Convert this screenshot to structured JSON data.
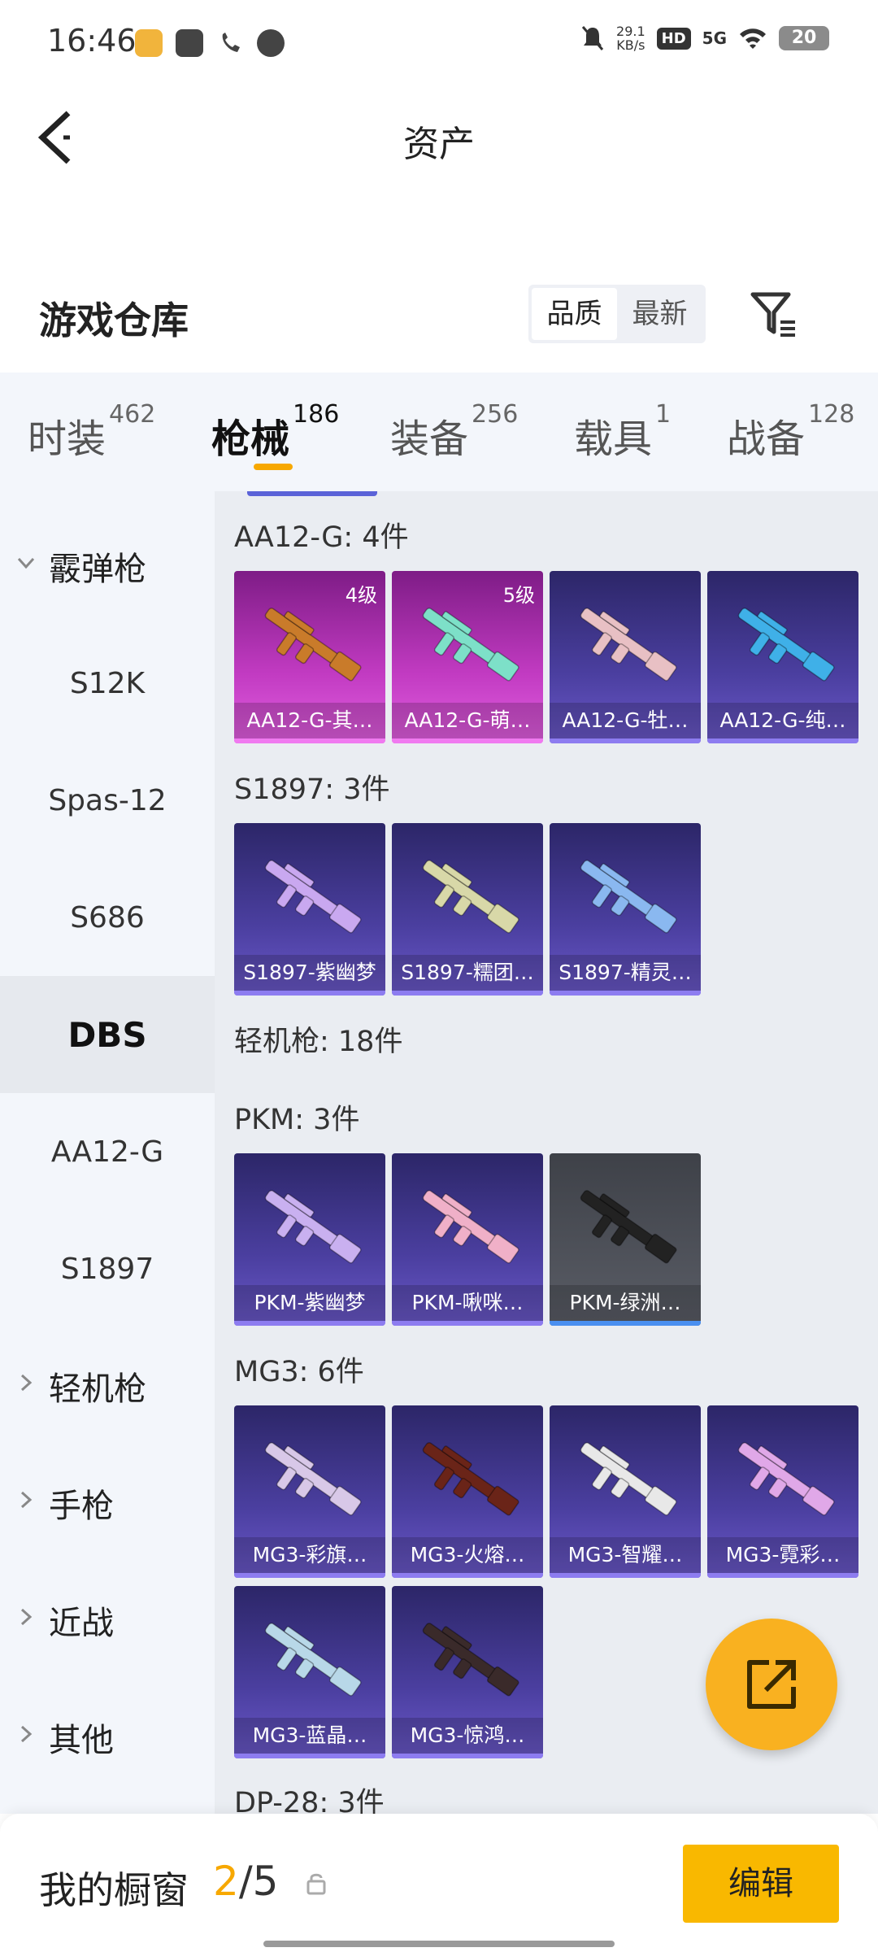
{
  "status_bar": {
    "time": "16:46",
    "net_speed_value": "29.1",
    "net_speed_unit": "KB/s",
    "hd": "HD",
    "signal": "5G",
    "battery": "20"
  },
  "header": {
    "title": "资产"
  },
  "warehouse": {
    "title": "游戏仓库",
    "sort_options": [
      "品质",
      "最新"
    ],
    "sort_active": "品质"
  },
  "tabs": [
    {
      "label": "时装",
      "count": "462"
    },
    {
      "label": "枪械",
      "count": "186",
      "active": true
    },
    {
      "label": "装备",
      "count": "256"
    },
    {
      "label": "载具",
      "count": "1"
    },
    {
      "label": "战备",
      "count": "128"
    }
  ],
  "sidebar": {
    "items": [
      {
        "label": "霰弹枪",
        "type": "group",
        "expanded": true
      },
      {
        "label": "S12K"
      },
      {
        "label": "Spas-12"
      },
      {
        "label": "S686"
      },
      {
        "label": "DBS",
        "active": true
      },
      {
        "label": "AA12-G"
      },
      {
        "label": "S1897"
      },
      {
        "label": "轻机枪",
        "type": "group"
      },
      {
        "label": "手枪",
        "type": "group"
      },
      {
        "label": "近战",
        "type": "group"
      },
      {
        "label": "其他",
        "type": "group"
      }
    ]
  },
  "sections": [
    {
      "title": "AA12-G: 4件",
      "items": [
        {
          "name": "AA12-G-其…",
          "level": "4级",
          "rarity": "pink",
          "gun_color": "#c97b2a"
        },
        {
          "name": "AA12-G-萌…",
          "level": "5级",
          "rarity": "pink",
          "gun_color": "#7de0c8"
        },
        {
          "name": "AA12-G-牡…",
          "rarity": "purple",
          "gun_color": "#e8c0c4"
        },
        {
          "name": "AA12-G-纯…",
          "rarity": "purple",
          "gun_color": "#3fb0e8"
        }
      ]
    },
    {
      "title": "S1897: 3件",
      "items": [
        {
          "name": "S1897-紫幽梦",
          "rarity": "purple",
          "gun_color": "#c9a8f0"
        },
        {
          "name": "S1897-糯团…",
          "rarity": "purple",
          "gun_color": "#d8d8a8"
        },
        {
          "name": "S1897-精灵…",
          "rarity": "purple",
          "gun_color": "#8ab8f0"
        }
      ]
    },
    {
      "title": "轻机枪: 18件",
      "items": []
    },
    {
      "title": "PKM: 3件",
      "items": [
        {
          "name": "PKM-紫幽梦",
          "rarity": "purple",
          "gun_color": "#c9b0f0"
        },
        {
          "name": "PKM-啾咪…",
          "rarity": "purple",
          "gun_color": "#f0b0c8"
        },
        {
          "name": "PKM-绿洲…",
          "rarity": "grey",
          "gun_color": "#222222"
        }
      ]
    },
    {
      "title": "MG3: 6件",
      "items": [
        {
          "name": "MG3-彩旗…",
          "rarity": "purple",
          "gun_color": "#d8c8e8"
        },
        {
          "name": "MG3-火熔…",
          "rarity": "purple",
          "gun_color": "#6a2418"
        },
        {
          "name": "MG3-智耀…",
          "rarity": "purple",
          "gun_color": "#e8e8e8"
        },
        {
          "name": "MG3-霓彩…",
          "rarity": "purple",
          "gun_color": "#e0a8e8"
        },
        {
          "name": "MG3-蓝晶…",
          "rarity": "purple",
          "gun_color": "#b8d8e8"
        },
        {
          "name": "MG3-惊鸿…",
          "rarity": "purple",
          "gun_color": "#3a2a2a"
        }
      ]
    },
    {
      "title": "DP-28: 3件",
      "items": []
    }
  ],
  "bottom": {
    "showcase_label": "我的橱窗",
    "showcase_current": "2",
    "showcase_total": "/5",
    "edit_label": "编辑"
  },
  "colors": {
    "accent": "#f7a800",
    "edit_button": "#f9b800",
    "fab": "#f9b120"
  }
}
